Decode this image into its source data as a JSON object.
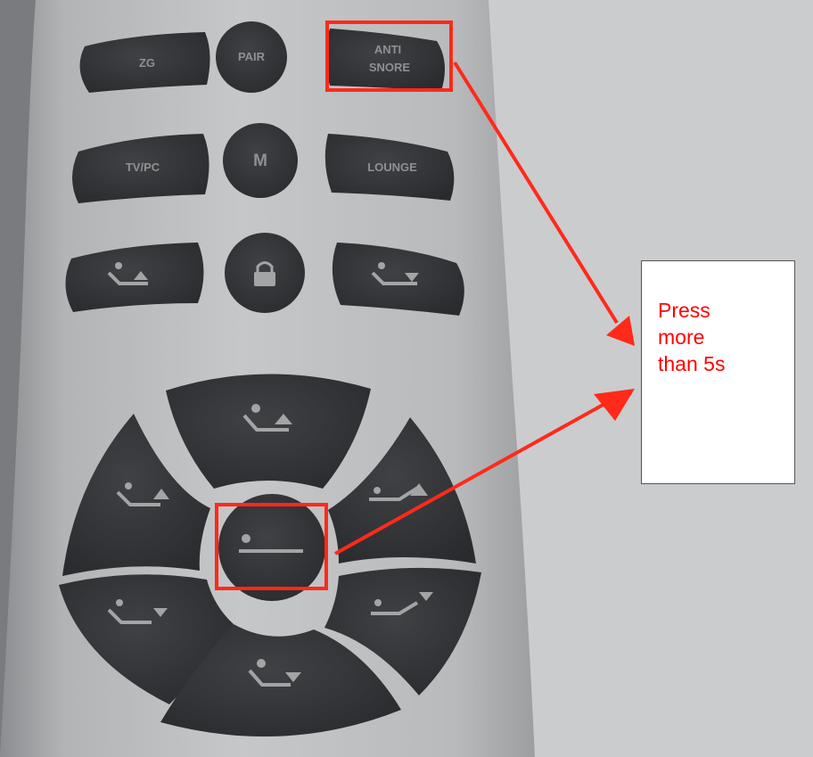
{
  "remote": {
    "buttons": {
      "zero_g": "ZG",
      "pair": "PAIR",
      "anti_snore_line1": "ANTI",
      "anti_snore_line2": "SNORE",
      "tv_pc": "TV/PC",
      "memory": "M",
      "lounge": "LOUNGE"
    },
    "icons": {
      "head_up": "head-up-icon",
      "lock": "lock-icon",
      "head_down": "head-down-icon",
      "flat": "flat-icon"
    }
  },
  "annotation": {
    "callout_text": "Press\nmore\nthan 5s",
    "highlight_color": "#ff2a1a",
    "text_color": "#ff0000"
  }
}
